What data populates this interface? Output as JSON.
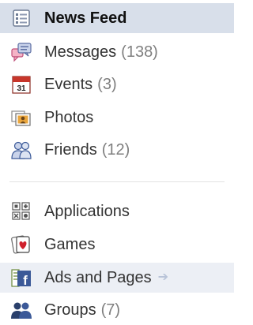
{
  "nav_top": [
    {
      "label": "News Feed",
      "icon": "news-feed-icon"
    },
    {
      "label": "Messages",
      "count": "(138)",
      "icon": "messages-icon"
    },
    {
      "label": "Events",
      "count": "(3)",
      "icon": "events-calendar-icon",
      "icon_text": "31"
    },
    {
      "label": "Photos",
      "icon": "photos-icon"
    },
    {
      "label": "Friends",
      "count": "(12)",
      "icon": "friends-icon"
    }
  ],
  "nav_bottom": [
    {
      "label": "Applications",
      "icon": "applications-icon"
    },
    {
      "label": "Games",
      "icon": "games-icon"
    },
    {
      "label": "Ads and Pages",
      "icon": "ads-pages-icon",
      "icon_text": "f"
    },
    {
      "label": "Groups",
      "count": "(7)",
      "icon": "groups-icon"
    }
  ],
  "colors": {
    "selected_bg": "#d8dfea",
    "hover_bg": "#eceff5",
    "count_text": "#7f7f7f",
    "facebook_blue": "#3b5998"
  }
}
